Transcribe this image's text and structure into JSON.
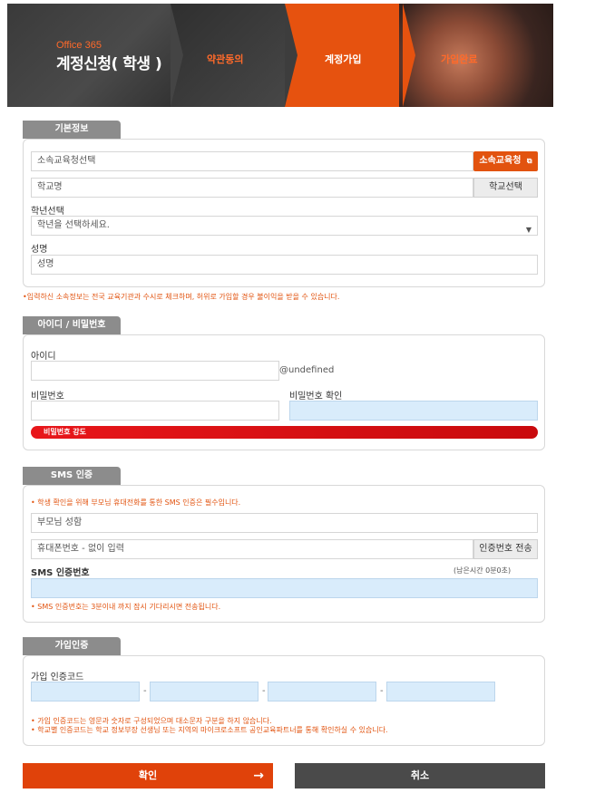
{
  "header": {
    "brand": "Office 365",
    "title": "계정신청( 학생 )",
    "steps": [
      "약관동의",
      "계정가입",
      "가입완료"
    ]
  },
  "basic": {
    "tab": "기본정보",
    "edu_office_placeholder": "소속교육청선택",
    "edu_office_button": "소속교육청",
    "school_placeholder": "학교명",
    "school_button": "학교선택",
    "grade_label": "학년선택",
    "grade_value": "학년을 선택하세요.",
    "name_label": "성명",
    "name_placeholder": "성명",
    "notice": "•입력하신 소속정보는 전국 교육기관과 수시로 체크하며, 허위로 가입할 경우 불이익을 받을 수 있습니다."
  },
  "account": {
    "tab": "아이디 / 비밀번호",
    "id_label": "아이디",
    "domain": "@undefined",
    "pw_label": "비밀번호",
    "pw_confirm_label": "비밀번호 확인",
    "strength_label": "비밀번호 강도",
    "strength_level": 1.0
  },
  "sms": {
    "tab": "SMS 인증",
    "notice": "• 학생 확인을 위해 부모님 휴대전화를 통한 SMS 인증은 필수입니다.",
    "parent_name_placeholder": "부모님 성함",
    "phone_placeholder": "휴대폰번호 - 없이 입력",
    "send_button": "인증번호 전송",
    "code_label": "SMS 인증번호",
    "remaining": "(남은시간 0분0초)",
    "code_notice": "• SMS 인증번호는 3분이내 까지 잠시 기다리시면 전송됩니다."
  },
  "join": {
    "tab": "가입인증",
    "code_label": "가입 인증코드",
    "dash": "-",
    "notice1": "• 가입 인증코드는 영문과 숫자로 구성되었으며 대소문자 구분을 하지 않습니다.",
    "notice2": "• 학교별 인증코드는 학교 정보부장 선생님 또는 지역의 마이크로소프트 공인교육파트너를 통해 확인하실 수 있습니다."
  },
  "actions": {
    "confirm": "확인",
    "cancel": "취소",
    "arrow_icon": "arrow-right-icon"
  }
}
